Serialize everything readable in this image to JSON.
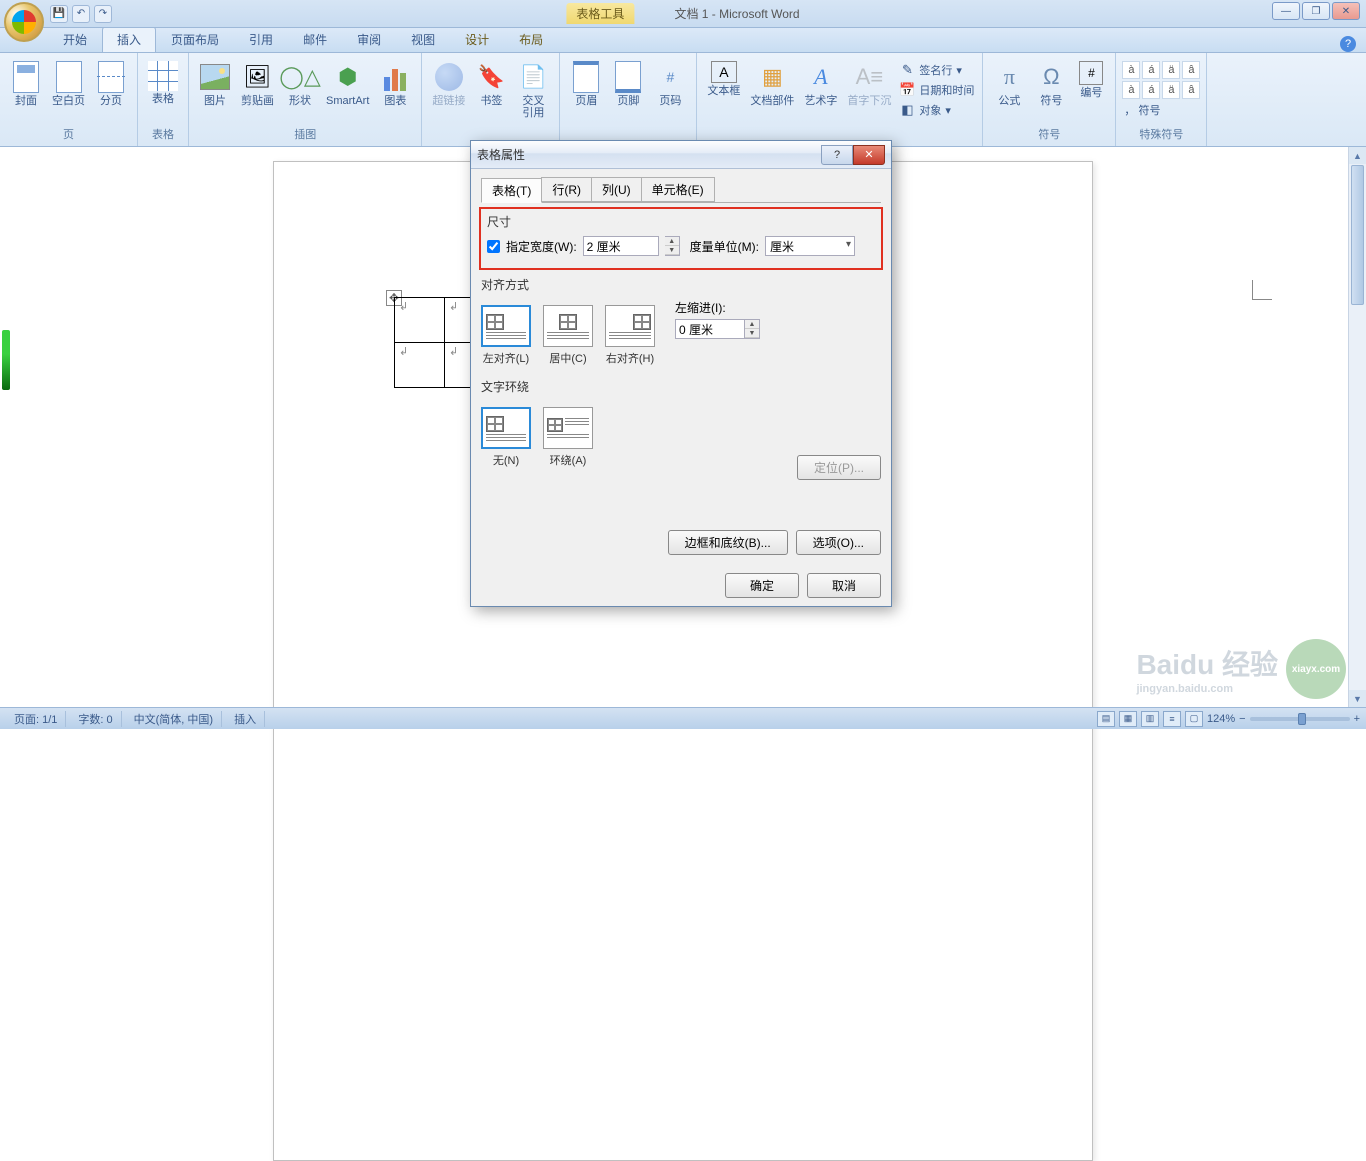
{
  "title": {
    "doc": "文档 1 - Microsoft Word",
    "context_tab": "表格工具"
  },
  "tabs": [
    "开始",
    "插入",
    "页面布局",
    "引用",
    "邮件",
    "审阅",
    "视图",
    "设计",
    "布局"
  ],
  "active_tab_index": 1,
  "ribbon": {
    "groups": [
      {
        "label": "页",
        "items": [
          {
            "l": "封面",
            "k": "cover"
          },
          {
            "l": "空白页",
            "k": "blank"
          },
          {
            "l": "分页",
            "k": "break"
          }
        ]
      },
      {
        "label": "表格",
        "items": [
          {
            "l": "表格",
            "k": "table"
          }
        ]
      },
      {
        "label": "插图",
        "items": [
          {
            "l": "图片",
            "k": "pic"
          },
          {
            "l": "剪贴画",
            "k": "clip"
          },
          {
            "l": "形状",
            "k": "shapes"
          },
          {
            "l": "SmartArt",
            "k": "smartart"
          },
          {
            "l": "图表",
            "k": "chart"
          }
        ]
      },
      {
        "label": "",
        "items": [
          {
            "l": "超链接",
            "k": "link",
            "disabled": true
          },
          {
            "l": "书签",
            "k": "bookmark"
          },
          {
            "l": "交叉\n引用",
            "k": "xref"
          }
        ]
      },
      {
        "label": "",
        "items": [
          {
            "l": "页眉",
            "k": "header"
          },
          {
            "l": "页脚",
            "k": "footer"
          },
          {
            "l": "页码",
            "k": "pagenum"
          }
        ]
      },
      {
        "label": "",
        "items": [
          {
            "l": "文本框",
            "k": "textbox"
          },
          {
            "l": "文档部件",
            "k": "parts"
          },
          {
            "l": "艺术字",
            "k": "wordart"
          },
          {
            "l": "首字下沉",
            "k": "dropcap",
            "disabled": true
          }
        ]
      },
      {
        "label": "",
        "small": [
          {
            "l": "签名行",
            "k": "sig"
          },
          {
            "l": "日期和时间",
            "k": "date"
          },
          {
            "l": "对象",
            "k": "obj"
          }
        ]
      },
      {
        "label": "符号",
        "items": [
          {
            "l": "公式",
            "k": "eq"
          },
          {
            "l": "符号",
            "k": "sym"
          },
          {
            "l": "编号",
            "k": "num"
          }
        ]
      },
      {
        "label": "特殊符号",
        "symbols": [
          "à",
          "á",
          "ä",
          "â",
          "à",
          "á",
          "ä",
          "â"
        ],
        "more": "， 符号"
      }
    ]
  },
  "dialog": {
    "title": "表格属性",
    "tabs": [
      "表格(T)",
      "行(R)",
      "列(U)",
      "单元格(E)"
    ],
    "active_tab": 0,
    "size_label": "尺寸",
    "width_chk": "指定宽度(W):",
    "width_val": "2 厘米",
    "unit_label": "度量单位(M):",
    "unit_val": "厘米",
    "align_label": "对齐方式",
    "aligns": [
      "左对齐(L)",
      "居中(C)",
      "右对齐(H)"
    ],
    "indent_label": "左缩进(I):",
    "indent_val": "0 厘米",
    "wrap_label": "文字环绕",
    "wraps": [
      "无(N)",
      "环绕(A)"
    ],
    "pos_btn": "定位(P)...",
    "border_btn": "边框和底纹(B)...",
    "options_btn": "选项(O)...",
    "ok": "确定",
    "cancel": "取消"
  },
  "status": {
    "page": "页面: 1/1",
    "words": "字数: 0",
    "lang": "中文(简体, 中国)",
    "mode": "插入",
    "zoom": "124%"
  },
  "watermark": {
    "brand": "Baidu 经验",
    "sub": "jingyan.baidu.com",
    "logo2": "xiayx.com"
  }
}
